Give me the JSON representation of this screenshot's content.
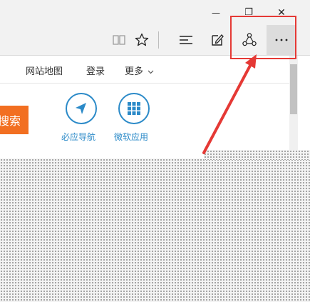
{
  "window_controls": {
    "minimize": "—",
    "restore": "❐",
    "close": "✕"
  },
  "toolbar": {
    "icons": [
      "reading-view-icon",
      "favorites-star-icon",
      "hub-icon",
      "web-note-icon",
      "share-icon",
      "more-icon"
    ]
  },
  "page": {
    "nav": {
      "sitemap": "网站地图",
      "login": "登录",
      "more": "更多"
    },
    "search_button_label": "搜索",
    "apps": [
      {
        "label": "必应导航",
        "icon": "navigation-arrow-icon"
      },
      {
        "label": "微软应用",
        "icon": "app-grid-icon"
      }
    ]
  },
  "colors": {
    "accent_blue": "#2b8ac8",
    "search_orange": "#f26f21",
    "annotation_red": "#e53935"
  }
}
